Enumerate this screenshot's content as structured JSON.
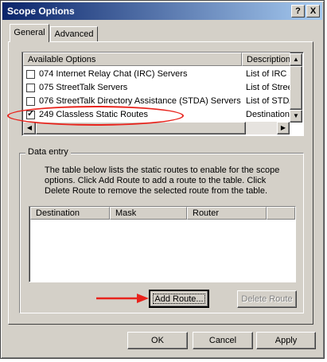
{
  "window": {
    "title": "Scope Options",
    "help_glyph": "?",
    "close_glyph": "X"
  },
  "tabs": [
    {
      "label": "General"
    },
    {
      "label": "Advanced"
    }
  ],
  "options_list": {
    "col_available": "Available Options",
    "col_description": "Description",
    "rows": [
      {
        "name": "074 Internet Relay Chat (IRC) Servers",
        "description": "List of IRC s",
        "checked": false
      },
      {
        "name": "075 StreetTalk Servers",
        "description": "List of Stree",
        "checked": false
      },
      {
        "name": "076 StreetTalk Directory Assistance (STDA) Servers",
        "description": "List of STDA",
        "checked": false
      },
      {
        "name": "249 Classless Static Routes",
        "description": "Destination,",
        "checked": true
      }
    ],
    "check_glyph": "✓",
    "arrows": {
      "up": "▲",
      "down": "▼",
      "left": "◀",
      "right": "▶"
    }
  },
  "data_entry": {
    "label": "Data entry",
    "description": "The table below lists the static routes to enable for the scope options.  Click Add Route to add a route to the table.  Click Delete Route to remove the selected route from the table.",
    "columns": [
      "Destination",
      "Mask",
      "Router"
    ],
    "add_route": "Add Route...",
    "delete_route": "Delete Route"
  },
  "footer": {
    "ok": "OK",
    "cancel": "Cancel",
    "apply": "Apply"
  },
  "colors": {
    "annotation": "#e8231c",
    "titlebar_start": "#0a246a",
    "dialog_face": "#d4d0c8"
  }
}
